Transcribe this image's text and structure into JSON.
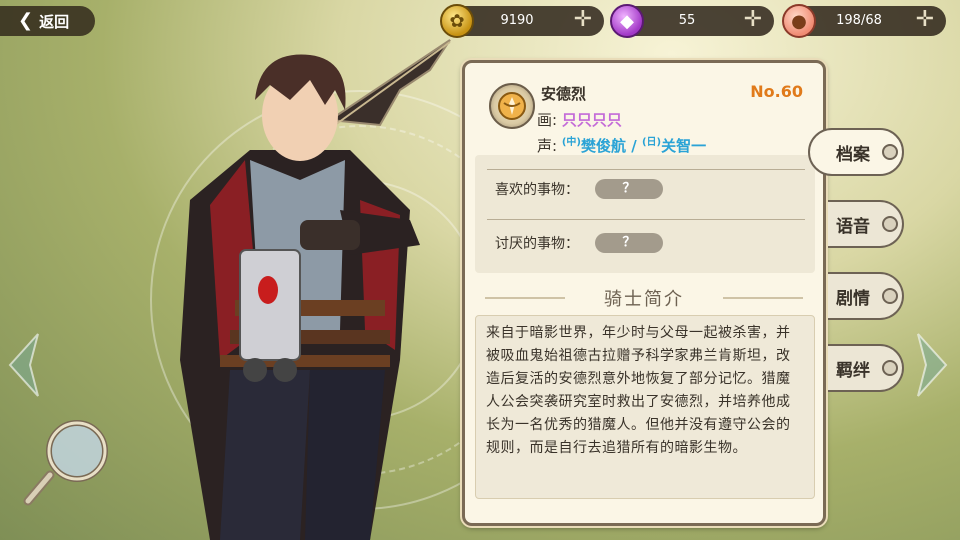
{
  "nav": {
    "back_label": "返回"
  },
  "resources": [
    {
      "icon": "coin-icon",
      "value": "9190"
    },
    {
      "icon": "gem-icon",
      "value": "55"
    },
    {
      "icon": "peach-icon",
      "value": "198/68"
    }
  ],
  "profile": {
    "name": "安德烈",
    "number": "No.60",
    "artist_label": "画:",
    "artist": "只只只只",
    "voice_label": "声:",
    "voice_cn_tag": "(中)",
    "voice_cn": "樊俊航",
    "voice_sep": " / ",
    "voice_jp_tag": "(日)",
    "voice_jp": "关智一",
    "likes_label": "喜欢的事物：",
    "likes_value": "？",
    "dislikes_label": "讨厌的事物：",
    "dislikes_value": "？",
    "intro_title": "骑士简介",
    "intro_text": "来自于暗影世界，年少时与父母一起被杀害，并被吸血鬼始祖德古拉赠予科学家弗兰肯斯坦，改造后复活的安德烈意外地恢复了部分记忆。猎魔人公会突袭研究室时救出了安德烈，并培养他成长为一名优秀的猎魔人。但他并没有遵守公会的规则，而是自行去追猎所有的暗影生物。"
  },
  "tabs": [
    {
      "label": "档案",
      "active": true
    },
    {
      "label": "语音",
      "active": false
    },
    {
      "label": "剧情",
      "active": false
    },
    {
      "label": "羁绊",
      "active": false
    }
  ],
  "colors": {
    "number": "#e07a1a",
    "artist": "#c46bd8",
    "voice_actor": "#2aa3d6",
    "panel_bg": "#fbf6e6"
  }
}
